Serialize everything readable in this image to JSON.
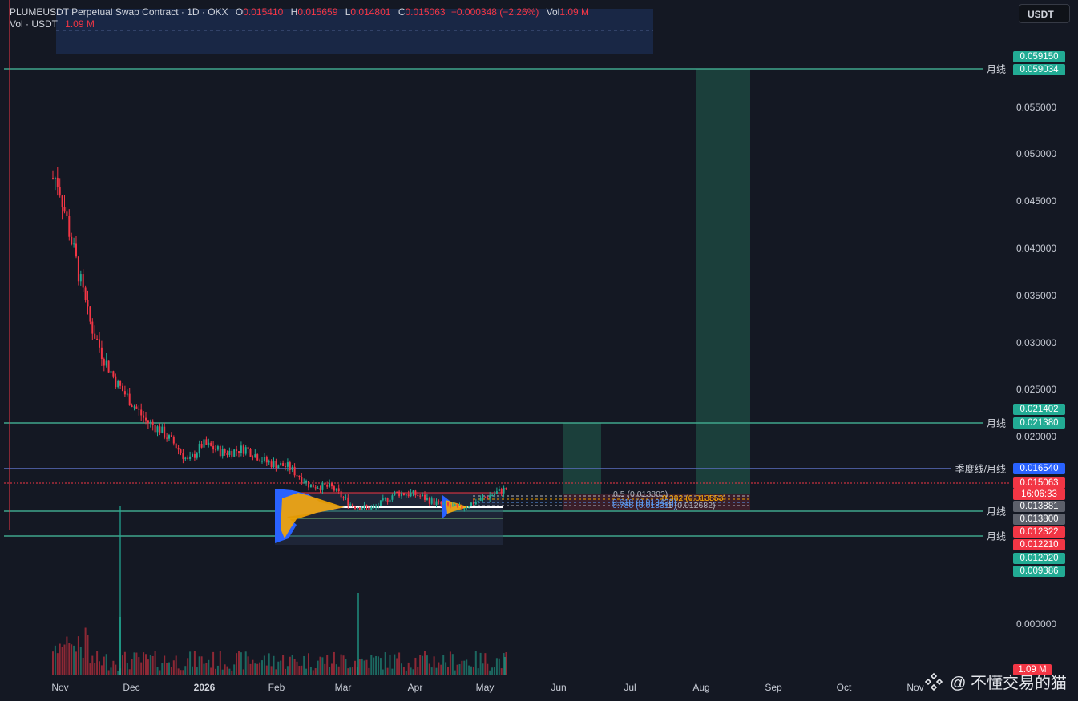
{
  "header": {
    "symbol": "PLUMEUSDT Perpetual Swap Contract · 1D · OKX",
    "open_label": "O",
    "open": "0.015410",
    "high_label": "H",
    "high": "0.015659",
    "low_label": "L",
    "low": "0.014801",
    "close_label": "C",
    "close": "0.015063",
    "change": "−0.000348 (−2.26%)",
    "vol_label": "Vol",
    "vol": "1.09 M",
    "vol_row_label": "Vol · USDT",
    "vol_row_value": "1.09 M"
  },
  "currency_button": "USDT",
  "y_ticks": [
    "0.055000",
    "0.050000",
    "0.045000",
    "0.040000",
    "0.035000",
    "0.030000",
    "0.025000",
    "0.020000",
    "0.000000"
  ],
  "x_ticks": [
    {
      "label": "Nov",
      "bold": false
    },
    {
      "label": "Dec",
      "bold": false
    },
    {
      "label": "2026",
      "bold": true
    },
    {
      "label": "Feb",
      "bold": false
    },
    {
      "label": "Mar",
      "bold": false
    },
    {
      "label": "Apr",
      "bold": false
    },
    {
      "label": "May",
      "bold": false
    },
    {
      "label": "Jun",
      "bold": false
    },
    {
      "label": "Jul",
      "bold": false
    },
    {
      "label": "Aug",
      "bold": false
    },
    {
      "label": "Sep",
      "bold": false
    },
    {
      "label": "Oct",
      "bold": false
    },
    {
      "label": "Nov",
      "bold": false
    }
  ],
  "price_badges": [
    {
      "text": "0.059150",
      "color": "#22ab94"
    },
    {
      "text": "0.059034",
      "color": "#22ab94"
    },
    {
      "text": "0.021402",
      "color": "#22ab94"
    },
    {
      "text": "0.021380",
      "color": "#22ab94"
    },
    {
      "text": "0.016540",
      "color": "#2962ff"
    },
    {
      "text": "0.015063",
      "color": "#f23645"
    },
    {
      "text": "16:06:33",
      "color": "#f23645"
    },
    {
      "text": "0.013881",
      "color": "#5d606b"
    },
    {
      "text": "0.013800",
      "color": "#5d606b"
    },
    {
      "text": "0.012322",
      "color": "#f23645"
    },
    {
      "text": "0.012210",
      "color": "#f23645"
    },
    {
      "text": "0.012020",
      "color": "#22ab94"
    },
    {
      "text": "0.009386",
      "color": "#22ab94"
    }
  ],
  "volume_badge": "1.09 M",
  "line_labels": [
    "月线",
    "月线",
    "季度线/月线",
    "月线",
    "月线"
  ],
  "fib_labels": [
    {
      "text": "0.5 (0.013803)",
      "color": "#b2b5be"
    },
    {
      "text": "0.382 (0.013553)",
      "color": "#f7a600"
    },
    {
      "text": "0.618 (0.013430)",
      "color": "#5b9cf6"
    },
    {
      "text": "0.786 (0.013310)",
      "color": "#5b9cf6"
    },
    {
      "text": "1 (0.012682)",
      "color": "#b2b5be"
    }
  ],
  "chart_data": {
    "type": "candlestick",
    "y_range": [
      0.0,
      0.061
    ],
    "x_range": [
      "Oct",
      "Nov"
    ],
    "price_path": [
      [
        0.0,
        0.062
      ],
      [
        0.4,
        0.06
      ],
      [
        0.8,
        0.052
      ],
      [
        1.0,
        0.047
      ],
      [
        1.2,
        0.04
      ],
      [
        1.4,
        0.033
      ],
      [
        1.6,
        0.029
      ],
      [
        1.8,
        0.026
      ],
      [
        2.0,
        0.024
      ],
      [
        2.2,
        0.022
      ],
      [
        2.4,
        0.021
      ],
      [
        2.6,
        0.0195
      ],
      [
        2.8,
        0.0175
      ],
      [
        3.0,
        0.0195
      ],
      [
        3.3,
        0.0185
      ],
      [
        3.6,
        0.019
      ],
      [
        3.9,
        0.0175
      ],
      [
        4.2,
        0.017
      ],
      [
        4.5,
        0.015
      ],
      [
        4.8,
        0.0148
      ],
      [
        5.1,
        0.0128
      ],
      [
        5.4,
        0.0125
      ],
      [
        5.7,
        0.0142
      ],
      [
        6.0,
        0.014
      ],
      [
        6.3,
        0.013
      ],
      [
        6.6,
        0.0125
      ],
      [
        6.9,
        0.0135
      ],
      [
        7.2,
        0.0145
      ],
      [
        7.5,
        0.015
      ],
      [
        7.8,
        0.016
      ],
      [
        8.0,
        0.0152
      ]
    ],
    "horizontal_levels": [
      0.059034,
      0.02138,
      0.01654,
      0.013881,
      0.01221
    ],
    "current_price": 0.015063
  },
  "watermark": {
    "text": "@ 不懂交易的猫",
    "icon": "binance-square-icon"
  },
  "colors": {
    "up": "#22ab94",
    "down": "#f23645",
    "level": "#3fa58b",
    "quarter_level": "#5b6dbf",
    "background": "#141823"
  }
}
